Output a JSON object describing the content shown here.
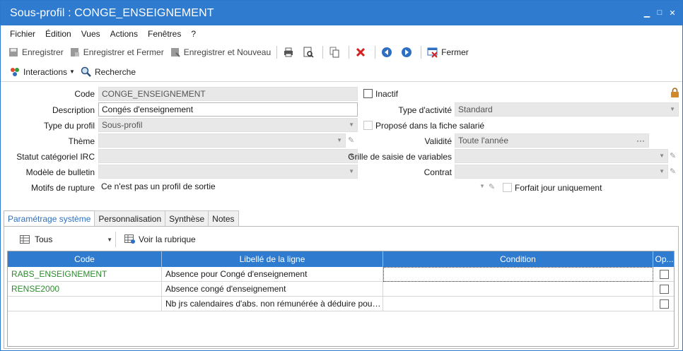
{
  "window": {
    "title": "Sous-profil : CONGE_ENSEIGNEMENT"
  },
  "menu": [
    "Fichier",
    "Édition",
    "Vues",
    "Actions",
    "Fenêtres",
    "?"
  ],
  "toolbar": {
    "save": "Enregistrer",
    "save_close": "Enregistrer et Fermer",
    "save_new": "Enregistrer et Nouveau",
    "close": "Fermer"
  },
  "toolbar2": {
    "interactions": "Interactions",
    "search": "Recherche"
  },
  "form": {
    "code_label": "Code",
    "code_value": "CONGE_ENSEIGNEMENT",
    "inactive_label": "Inactif",
    "description_label": "Description",
    "description_value": "Congés d'enseignement",
    "activity_type_label": "Type d'activité",
    "activity_type_value": "Standard",
    "profile_type_label": "Type du profil",
    "profile_type_value": "Sous-profil",
    "proposed_label": "Proposé dans la fiche salarié",
    "theme_label": "Thème",
    "theme_value": "",
    "validity_label": "Validité",
    "validity_value": "Toute l'année",
    "irc_label": "Statut catégoriel IRC",
    "irc_value": "",
    "variables_grid_label": "Grille de saisie de variables",
    "variables_grid_value": "",
    "bulletin_label": "Modèle de bulletin",
    "bulletin_value": "",
    "contract_label": "Contrat",
    "contract_value": "",
    "rupture_label": "Motifs de rupture",
    "rupture_value": "Ce n'est pas un profil de sortie",
    "forfait_label": "Forfait jour uniquement"
  },
  "tabs": [
    "Paramétrage système",
    "Personnalisation",
    "Synthèse",
    "Notes"
  ],
  "subtoolbar": {
    "filter_value": "Tous",
    "view_rubric": "Voir la rubrique"
  },
  "grid": {
    "headers": [
      "Code",
      "Libellé de la ligne",
      "Condition",
      "Op..."
    ],
    "rows": [
      {
        "code": "RABS_ENSEIGNEMENT",
        "label": "Absence pour Congé d'enseignement",
        "condition": ""
      },
      {
        "code": "RENSE2000",
        "label": "Absence congé d'enseignement",
        "condition": ""
      },
      {
        "code": "",
        "label": "Nb jrs calendaires d'abs. non rémunérée à déduire pour le cal...",
        "condition": ""
      }
    ]
  },
  "colors": {
    "accent": "#2e7bd0",
    "code_green": "#2f8a2f"
  }
}
